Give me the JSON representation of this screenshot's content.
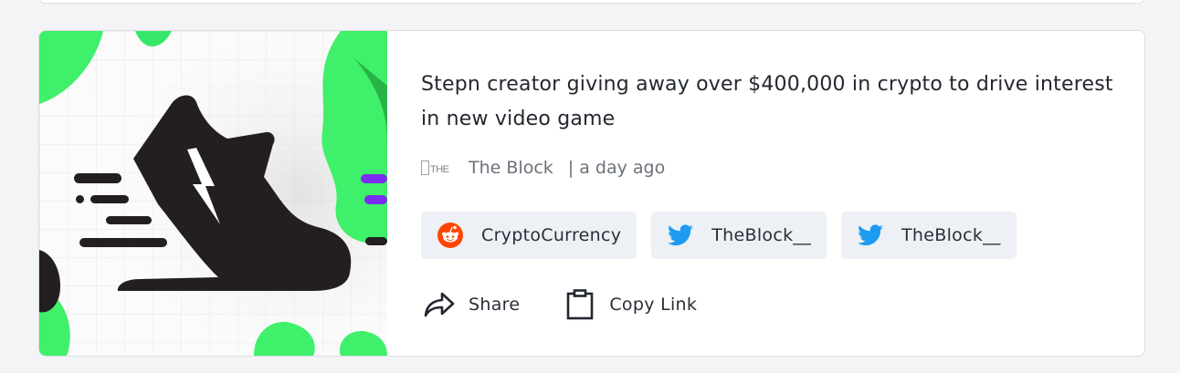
{
  "article": {
    "title": "Stepn creator giving away over $400,000 in crypto to drive interest in new video game",
    "source_logo_text": "THE BLOCK",
    "source_name": "The Block",
    "time_ago": "| a day ago"
  },
  "tags": [
    {
      "label": "CryptoCurrency",
      "icon": "reddit-icon"
    },
    {
      "label": "TheBlock__",
      "icon": "twitter-icon"
    },
    {
      "label": "TheBlock__",
      "icon": "twitter-icon"
    }
  ],
  "actions": {
    "share_label": "Share",
    "copy_label": "Copy Link"
  },
  "colors": {
    "reddit": "#ff4500",
    "twitter": "#1d9bf0",
    "thumb_green": "#3ff06a",
    "thumb_purple": "#7b2cf0",
    "shoe": "#231f20"
  }
}
